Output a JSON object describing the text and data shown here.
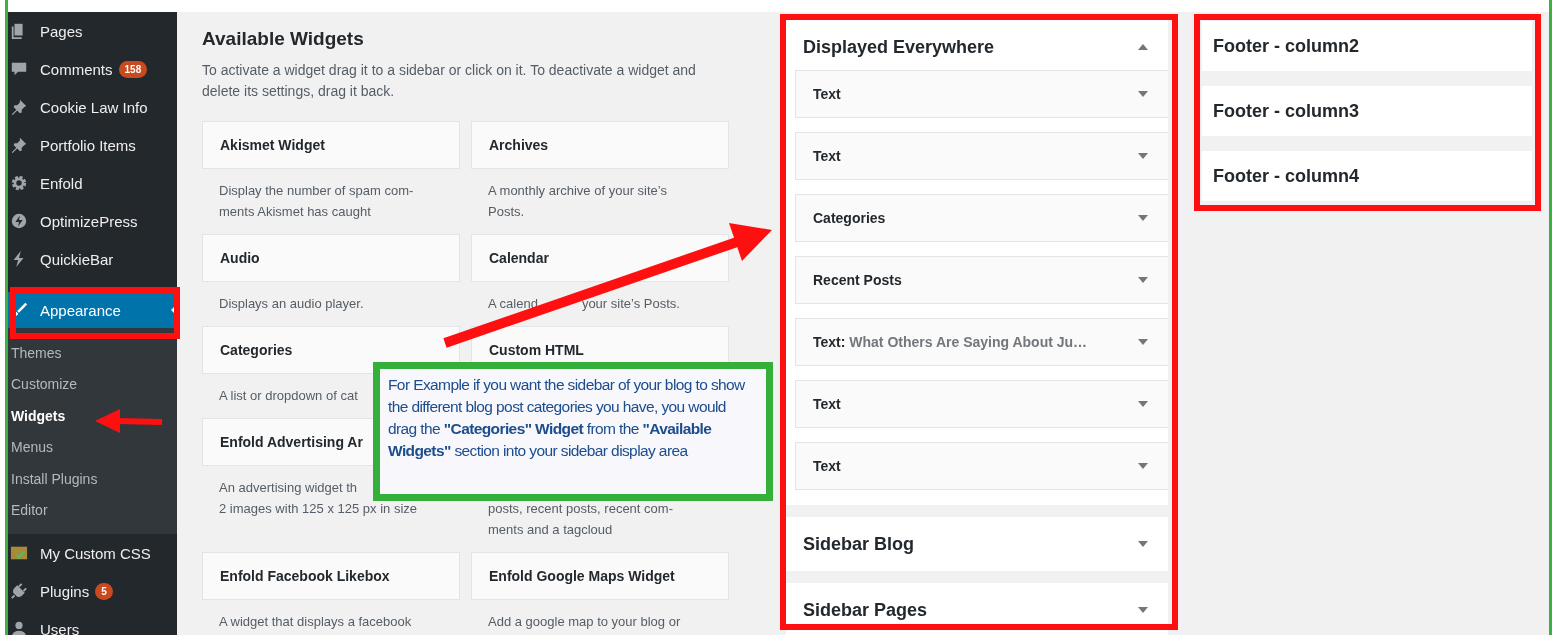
{
  "admin_menu": {
    "groups": [
      {
        "items": [
          {
            "label": "Pages",
            "selected": false
          },
          {
            "label": "Comments",
            "badge": "158",
            "selected": false
          },
          {
            "label": "Cookie Law Info",
            "selected": false
          },
          {
            "label": "Portfolio Items",
            "selected": false
          },
          {
            "label": "Enfold",
            "selected": false
          },
          {
            "label": "OptimizePress",
            "selected": false
          },
          {
            "label": "QuickieBar",
            "selected": false
          }
        ]
      },
      {
        "items": [
          {
            "label": "Appearance",
            "selected": true,
            "expanded": true,
            "children": [
              {
                "label": "Themes",
                "selected": false
              },
              {
                "label": "Customize",
                "selected": false
              },
              {
                "label": "Widgets",
                "selected": true
              },
              {
                "label": "Menus",
                "selected": false
              },
              {
                "label": "Install Plugins",
                "selected": false
              },
              {
                "label": "Editor",
                "selected": false
              }
            ]
          },
          {
            "label": "My Custom CSS",
            "selected": false
          },
          {
            "label": "Plugins",
            "badge": "5",
            "selected": false
          },
          {
            "label": "Users",
            "selected": false
          }
        ]
      }
    ]
  },
  "available_widgets": {
    "title": "Available Widgets",
    "description": "To activate a widget drag it to a sidebar or click on it. To deactivate a widget and delete its settings, drag it back.",
    "items": [
      {
        "title": "Akismet Widget",
        "description": [
          "Display the number of spam com-",
          "ments Akismet has caught"
        ]
      },
      {
        "title": "Archives",
        "description": [
          "A monthly archive of your site’s",
          "Posts."
        ]
      },
      {
        "title": "Audio",
        "description": [
          "Displays an audio player."
        ]
      },
      {
        "title": "Calendar",
        "description": [
          [
            "A calend",
            "your site’s Posts."
          ]
        ]
      },
      {
        "title": "Categories",
        "description": [
          "A list or dropdown of cat"
        ]
      },
      {
        "title": "Custom HTML"
      },
      {
        "title": "Enfold Advertising Ar",
        "description": [
          "An advertising widget th",
          "2 images with 125 x 125 px in size"
        ]
      },
      {
        "description": [
          "posts, recent posts, recent com-",
          "ments and a tagcloud"
        ]
      },
      {
        "title": "Enfold Facebook Likebox",
        "description": [
          "A widget that displays a facebook"
        ]
      },
      {
        "title": "Enfold Google Maps Widget",
        "description": [
          "Add a google map to your blog or"
        ]
      }
    ]
  },
  "widget_areas": [
    {
      "title": "Displayed Everywhere",
      "expanded": true,
      "widgets": [
        {
          "title": "Text",
          "expanded": false
        },
        {
          "title": "Text",
          "expanded": false
        },
        {
          "title": "Categories",
          "expanded": false
        },
        {
          "title": "Recent Posts",
          "expanded": false
        },
        {
          "title": "Text:",
          "subtitle": "What Others Are Saying About Ju…",
          "expanded": false
        },
        {
          "title": "Text",
          "expanded": false
        },
        {
          "title": "Text",
          "expanded": false
        }
      ]
    },
    {
      "title": "Sidebar Blog",
      "expanded": false
    },
    {
      "title": "Sidebar Pages",
      "expanded": false
    }
  ],
  "footer_areas": [
    {
      "title": "Footer - column2"
    },
    {
      "title": "Footer - column3"
    },
    {
      "title": "Footer - column4"
    }
  ],
  "callout": {
    "text": "For Example if you want the sidebar of your blog to show the different blog post categories you have, you would drag the **\"Categories\" Widget** from the **\"Available Widgets\"** section into your sidebar display area"
  }
}
